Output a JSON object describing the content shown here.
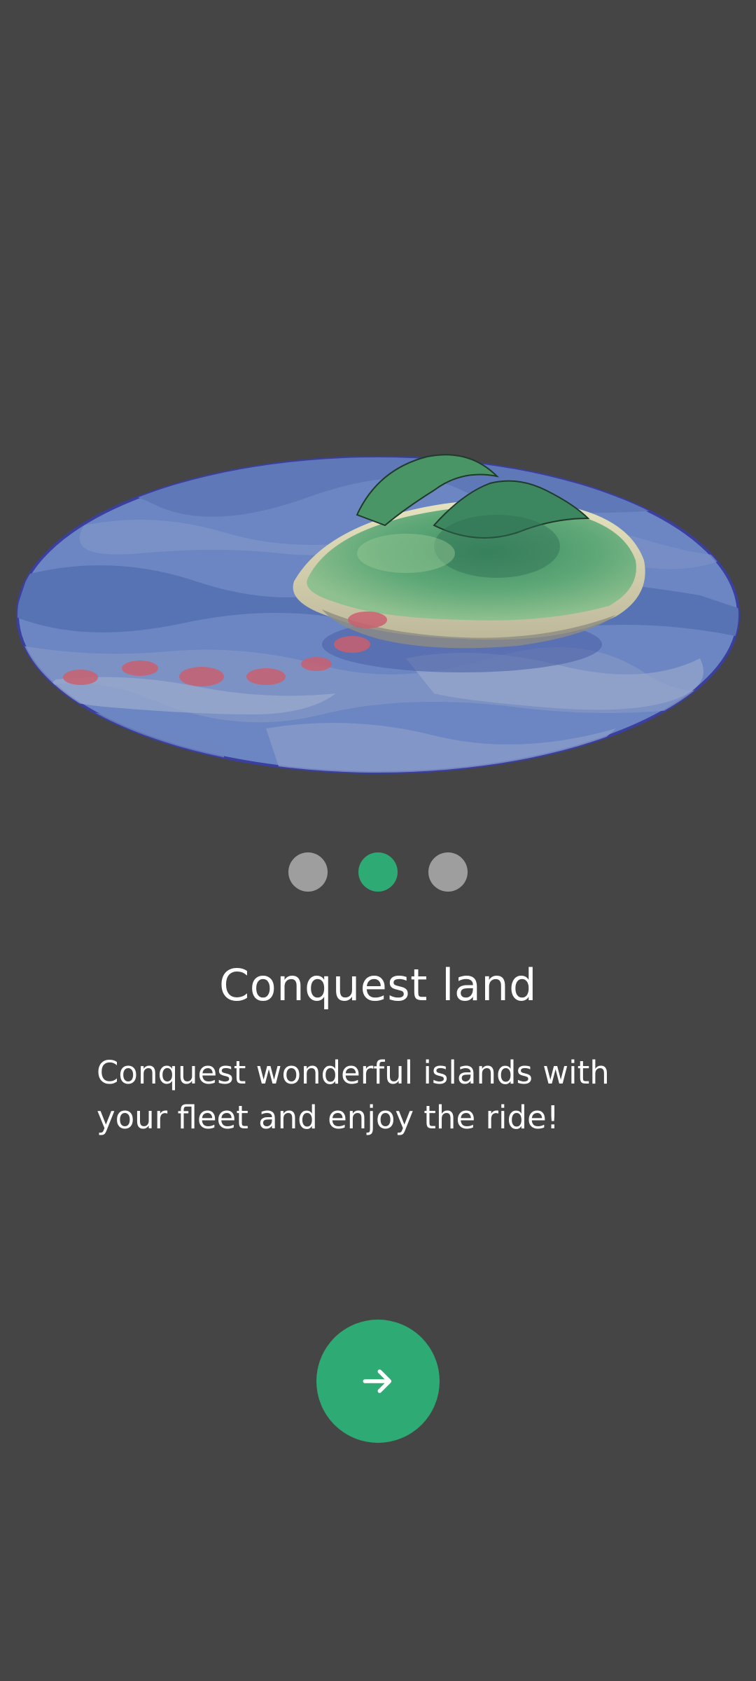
{
  "onboarding": {
    "title": "Conquest land",
    "description": "Conquest wonderful islands with your fleet and enjoy the ride!",
    "page_indicator": {
      "total": 3,
      "active_index": 1
    },
    "next_button_icon": "arrow-right-icon",
    "illustration": "island-map-illustration"
  },
  "colors": {
    "background": "#454545",
    "accent": "#2eaa74",
    "dot_inactive": "#9e9e9e",
    "text": "#ffffff"
  }
}
